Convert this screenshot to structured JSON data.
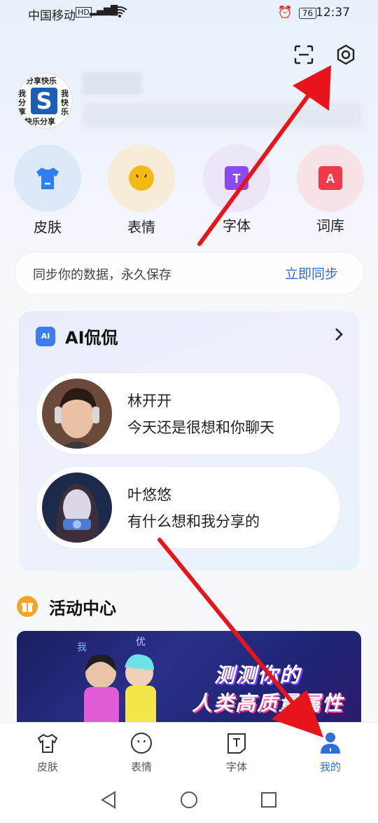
{
  "status_bar": {
    "carrier": "中国移动",
    "network": "HD",
    "signal": "4G",
    "battery": "76",
    "time": "12:37"
  },
  "profile": {
    "avatar_text_top": "分享快乐",
    "avatar_text_left": "我分享",
    "avatar_text_right": "我快乐",
    "avatar_text_bottom": "快乐分享",
    "avatar_letter": "S"
  },
  "quick_items": [
    {
      "label": "皮肤",
      "color": "#2f7df2",
      "bg": "#dde9f8"
    },
    {
      "label": "表情",
      "color": "#f5b916",
      "bg": "#f6ecd8"
    },
    {
      "label": "字体",
      "color": "#8a4cf2",
      "bg": "#ede6f8"
    },
    {
      "label": "词库",
      "color": "#f2394b",
      "bg": "#f7e3e6"
    }
  ],
  "quick_icon_letters": {
    "font": "T",
    "dict": "A"
  },
  "sync": {
    "text": "同步你的数据，永久保存",
    "action": "立即同步"
  },
  "ai_section": {
    "badge": "AI",
    "title": "AI侃侃",
    "chats": [
      {
        "name": "林开开",
        "message": "今天还是很想和你聊天"
      },
      {
        "name": "叶悠悠",
        "message": "有什么想和我分享的"
      }
    ]
  },
  "activity": {
    "title": "活动中心",
    "banner_line1": "测测你的",
    "banner_line2": "人类高质量属性"
  },
  "bottom_nav": [
    {
      "label": "皮肤"
    },
    {
      "label": "表情"
    },
    {
      "label": "字体"
    },
    {
      "label": "我的"
    }
  ],
  "colors": {
    "accent": "#2d6fd6",
    "arrow": "#e8141b"
  }
}
